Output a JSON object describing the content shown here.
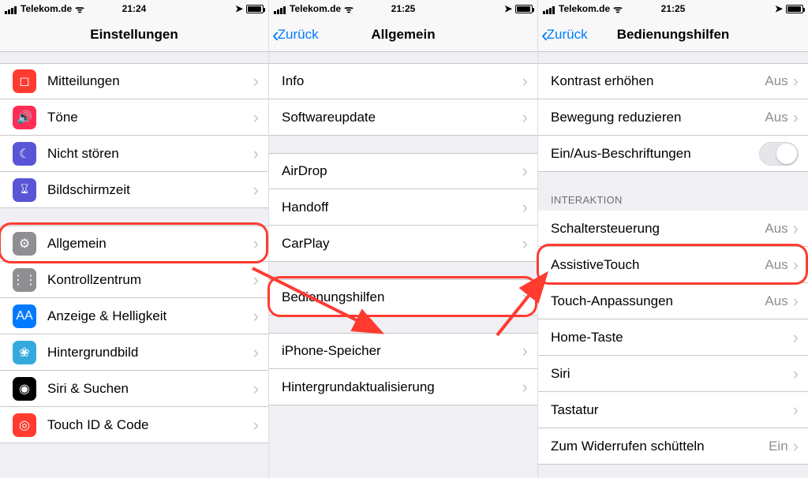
{
  "screens": [
    {
      "status": {
        "carrier": "Telekom.de",
        "time": "21:24"
      },
      "nav": {
        "back": null,
        "title": "Einstellungen"
      },
      "groups": [
        {
          "header": null,
          "cells": [
            {
              "icon": {
                "bg": "#ff3b30",
                "glyph": "◻︎"
              },
              "name": "notifications",
              "label": "Mitteilungen"
            },
            {
              "icon": {
                "bg": "#ff2d55",
                "glyph": "🔊"
              },
              "name": "sounds",
              "label": "Töne"
            },
            {
              "icon": {
                "bg": "#5856d6",
                "glyph": "☾"
              },
              "name": "do-not-disturb",
              "label": "Nicht stören"
            },
            {
              "icon": {
                "bg": "#5856d6",
                "glyph": "⌛︎"
              },
              "name": "screen-time",
              "label": "Bildschirmzeit"
            }
          ]
        },
        {
          "header": null,
          "cells": [
            {
              "icon": {
                "bg": "#8e8e93",
                "glyph": "⚙︎"
              },
              "name": "general",
              "label": "Allgemein",
              "highlight": true
            },
            {
              "icon": {
                "bg": "#8e8e93",
                "glyph": "⋮⋮"
              },
              "name": "control-center",
              "label": "Kontrollzentrum"
            },
            {
              "icon": {
                "bg": "#007aff",
                "glyph": "AA"
              },
              "name": "display",
              "label": "Anzeige & Helligkeit"
            },
            {
              "icon": {
                "bg": "#34aadc",
                "glyph": "❀"
              },
              "name": "wallpaper",
              "label": "Hintergrundbild"
            },
            {
              "icon": {
                "bg": "#000000",
                "glyph": "◉"
              },
              "name": "siri",
              "label": "Siri & Suchen"
            },
            {
              "icon": {
                "bg": "#ff3b30",
                "glyph": "◎"
              },
              "name": "touch-id",
              "label": "Touch ID & Code"
            }
          ]
        }
      ]
    },
    {
      "status": {
        "carrier": "Telekom.de",
        "time": "21:25"
      },
      "nav": {
        "back": "Zurück",
        "title": "Allgemein"
      },
      "groups": [
        {
          "header": null,
          "cells": [
            {
              "name": "about",
              "label": "Info"
            },
            {
              "name": "software-update",
              "label": "Softwareupdate"
            }
          ]
        },
        {
          "header": null,
          "cells": [
            {
              "name": "airdrop",
              "label": "AirDrop"
            },
            {
              "name": "handoff",
              "label": "Handoff"
            },
            {
              "name": "carplay",
              "label": "CarPlay"
            }
          ]
        },
        {
          "header": null,
          "cells": [
            {
              "name": "accessibility",
              "label": "Bedienungshilfen",
              "highlight": true
            }
          ]
        },
        {
          "header": null,
          "cells": [
            {
              "name": "iphone-storage",
              "label": "iPhone-Speicher"
            },
            {
              "name": "background-refresh",
              "label": "Hintergrundaktualisierung"
            }
          ]
        }
      ]
    },
    {
      "status": {
        "carrier": "Telekom.de",
        "time": "21:25"
      },
      "nav": {
        "back": "Zurück",
        "title": "Bedienungshilfen"
      },
      "groups": [
        {
          "header": null,
          "cells": [
            {
              "name": "increase-contrast",
              "label": "Kontrast erhöhen",
              "detail": "Aus"
            },
            {
              "name": "reduce-motion",
              "label": "Bewegung reduzieren",
              "detail": "Aus"
            },
            {
              "name": "on-off-labels",
              "label": "Ein/Aus-Beschriftungen",
              "switch": true
            }
          ]
        },
        {
          "header": "INTERAKTION",
          "cells": [
            {
              "name": "switch-control",
              "label": "Schaltersteuerung",
              "detail": "Aus"
            },
            {
              "name": "assistive-touch",
              "label": "AssistiveTouch",
              "detail": "Aus",
              "highlight": true
            },
            {
              "name": "touch-accommodations",
              "label": "Touch-Anpassungen",
              "detail": "Aus"
            },
            {
              "name": "home-button",
              "label": "Home-Taste"
            },
            {
              "name": "siri-accessibility",
              "label": "Siri"
            },
            {
              "name": "keyboard",
              "label": "Tastatur"
            },
            {
              "name": "shake-to-undo",
              "label": "Zum Widerrufen schütteln",
              "detail": "Ein"
            }
          ]
        }
      ]
    }
  ]
}
